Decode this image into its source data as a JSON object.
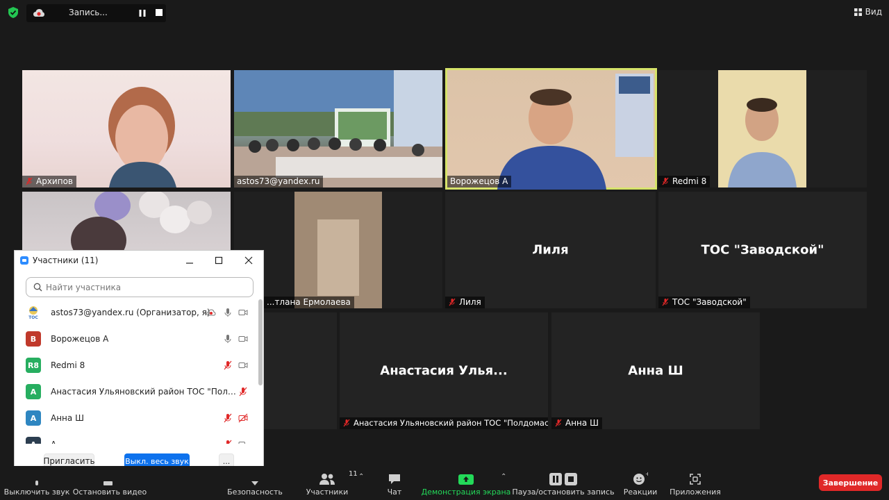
{
  "top_bar": {
    "recording_label": "Запись...",
    "view_label": "Вид"
  },
  "tiles": [
    {
      "name": "Архипов",
      "muted": true,
      "big_name": ""
    },
    {
      "name": "astos73@yandex.ru",
      "muted": false,
      "big_name": ""
    },
    {
      "name": "Ворожецов А",
      "muted": false,
      "big_name": "",
      "active": true
    },
    {
      "name": "Redmi 8",
      "muted": true,
      "big_name": ""
    },
    {
      "name": "",
      "muted": false,
      "big_name": ""
    },
    {
      "name": "...тлана Ермолаева",
      "muted": false,
      "big_name": ""
    },
    {
      "name": "Лиля",
      "muted": true,
      "big_name": "Лиля"
    },
    {
      "name": "ТОС \"Заводской\"",
      "muted": true,
      "big_name": "ТОС \"Заводской\""
    },
    {
      "name": "Анастасия Ульяновский район ТОС \"Полдомас...",
      "muted": true,
      "big_name": "Анастасия  Улья..."
    },
    {
      "name": "Анна Ш",
      "muted": true,
      "big_name": "Анна Ш"
    }
  ],
  "panel": {
    "title": "Участники (11)",
    "search_placeholder": "Найти участника",
    "participants": [
      {
        "initials": "",
        "color": "#ffffff",
        "name": "astos73@yandex.ru (Организатор, я)"
      },
      {
        "initials": "В",
        "color": "#c0392b",
        "name": "Ворожецов А"
      },
      {
        "initials": "R8",
        "color": "#27ae60",
        "name": "Redmi 8"
      },
      {
        "initials": "А",
        "color": "#27ae60",
        "name": "Анастасия Ульяновский район ТОС \"Полдомасово\""
      },
      {
        "initials": "А",
        "color": "#2e86c1",
        "name": "Анна Ш"
      },
      {
        "initials": "А",
        "color": "#2c3e50",
        "name": "А"
      }
    ],
    "invite_label": "Пригласить",
    "mute_all_label": "Выкл. весь звук",
    "more_label": "..."
  },
  "toolbar": {
    "mute_label": "Выключить звук",
    "video_label": "Остановить видео",
    "security_label": "Безопасность",
    "participants_label": "Участники",
    "participants_count": "11",
    "chat_label": "Чат",
    "share_label": "Демонстрация экрана",
    "record_label": "Пауза/остановить запись",
    "reactions_label": "Реакции",
    "apps_label": "Приложения",
    "end_label": "Завершение"
  },
  "colors": {
    "accent_blue": "#0e72ed",
    "end_red": "#e02828",
    "share_green": "#23d959",
    "active_speaker": "#d6e36a"
  }
}
